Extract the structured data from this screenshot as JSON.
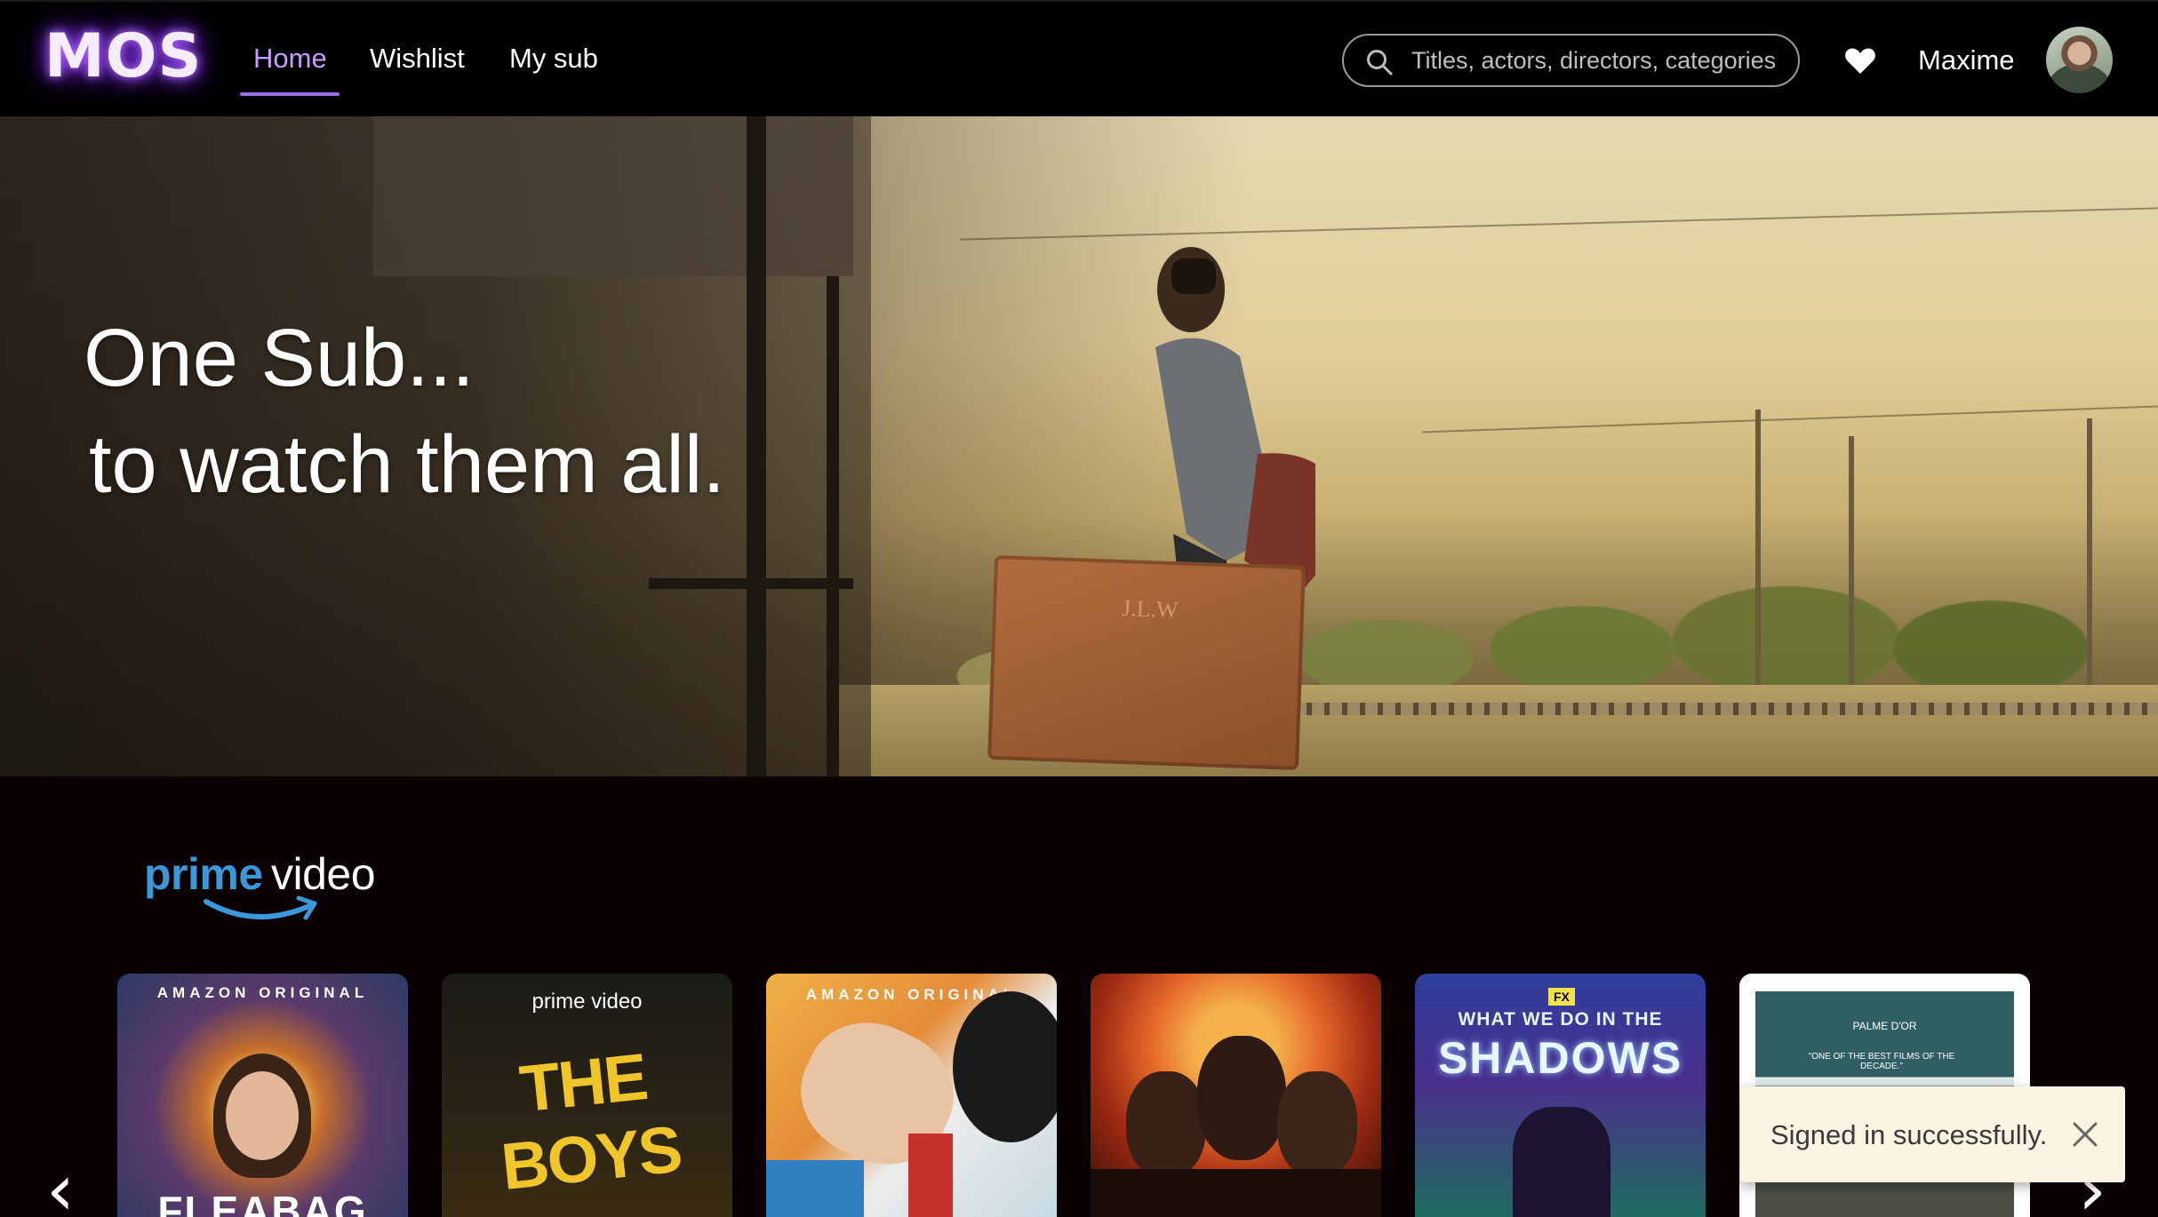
{
  "app": {
    "logo": "MOS"
  },
  "nav": {
    "links": [
      {
        "label": "Home",
        "active": true
      },
      {
        "label": "Wishlist",
        "active": false
      },
      {
        "label": "My sub",
        "active": false
      }
    ]
  },
  "search": {
    "placeholder": "Titles, actors, directors, categories",
    "value": ""
  },
  "user": {
    "name": "Maxime"
  },
  "hero": {
    "line1": "One Sub...",
    "line2": "to watch them all.",
    "suitcase_mark": "J.L.W"
  },
  "section": {
    "brand_word1": "prime",
    "brand_word2": "video"
  },
  "posters": [
    {
      "caption": "AMAZON ORIGINAL",
      "title": "FLEABAG"
    },
    {
      "caption": "prime video",
      "title": "THE BOYS"
    },
    {
      "caption": "AMAZON ORIGINAL",
      "title": ""
    },
    {
      "caption": "",
      "title": ""
    },
    {
      "caption": "WHAT WE DO IN THE",
      "title": "SHADOWS",
      "badge": "FX"
    },
    {
      "caption": "PALME D'OR",
      "title": "\"ONE OF THE BEST FILMS OF THE DECADE.\""
    }
  ],
  "carousel": {
    "prev": "‹",
    "next": "›"
  },
  "toast": {
    "message": "Signed in successfully."
  },
  "colors": {
    "accent": "#c79cff",
    "underline": "#9b6be8",
    "prime_blue": "#3a99d8",
    "toast_bg": "#fbf2e1"
  }
}
